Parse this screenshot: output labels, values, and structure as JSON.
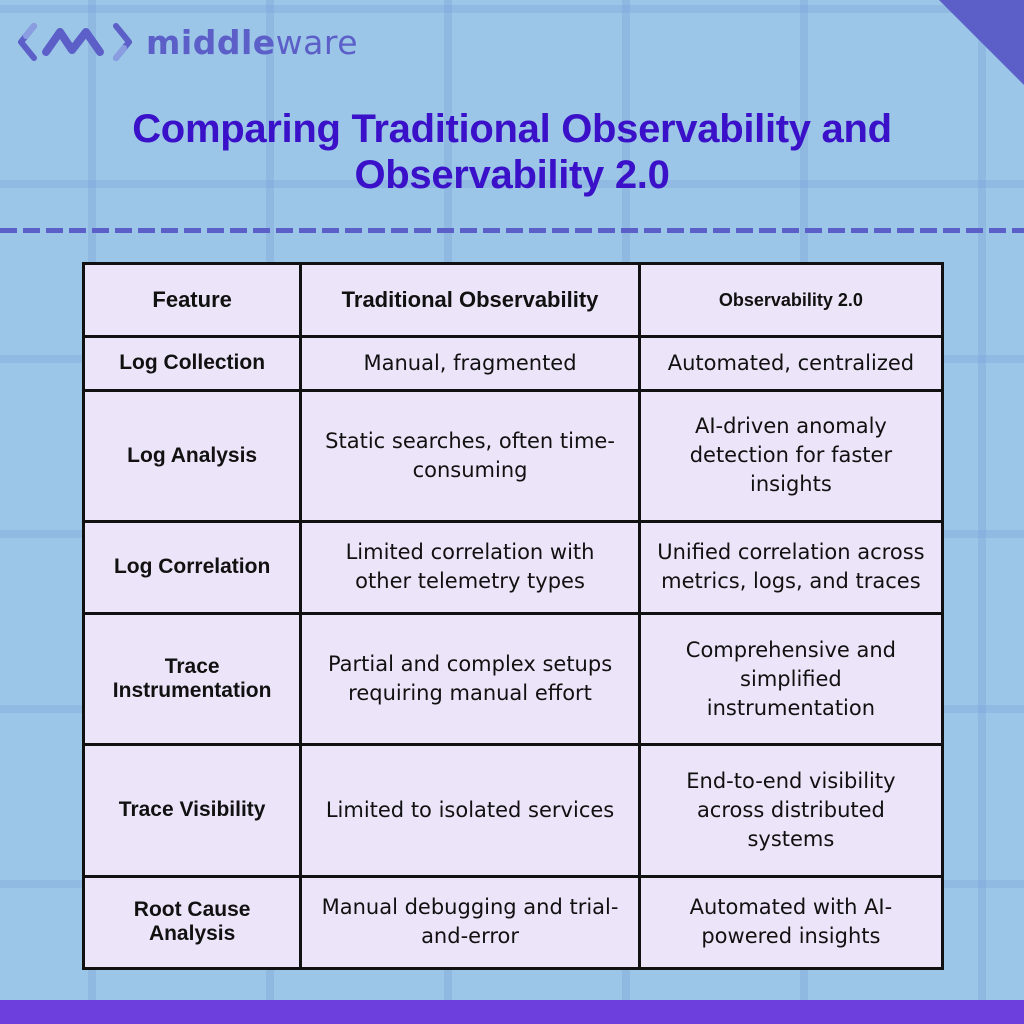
{
  "brand": {
    "logo_icon": "middleware-logo-icon",
    "name_bold": "middle",
    "name_light": "ware",
    "accent_color": "#5b5fc7"
  },
  "title": {
    "line1": "Comparing Traditional Observability and",
    "line2": "Observability 2.0",
    "color": "#3a10c8"
  },
  "table": {
    "headers": [
      "Feature",
      "Traditional Observability",
      "Observability 2.0"
    ],
    "rows": [
      {
        "feature": "Log Collection",
        "traditional": "Manual, fragmented",
        "v2": "Automated, centralized"
      },
      {
        "feature": "Log Analysis",
        "traditional": "Static searches, often time-consuming",
        "v2": "AI-driven anomaly detection for faster insights"
      },
      {
        "feature": "Log Correlation",
        "traditional": "Limited correlation with other telemetry types",
        "v2": "Unified correlation across metrics, logs, and traces"
      },
      {
        "feature": "Trace Instrumentation",
        "traditional": "Partial and complex setups requiring manual effort",
        "v2": "Comprehensive and simplified instrumentation"
      },
      {
        "feature": "Trace Visibility",
        "traditional": "Limited to isolated services",
        "v2": "End-to-end visibility across distributed systems"
      },
      {
        "feature": "Root Cause Analysis",
        "traditional": "Manual debugging and trial-and-error",
        "v2": "Automated with AI-powered insights"
      }
    ]
  },
  "colors": {
    "background": "#9cc6e8",
    "table_fill": "#ece4f8",
    "footer_bar": "#6d40dd"
  }
}
